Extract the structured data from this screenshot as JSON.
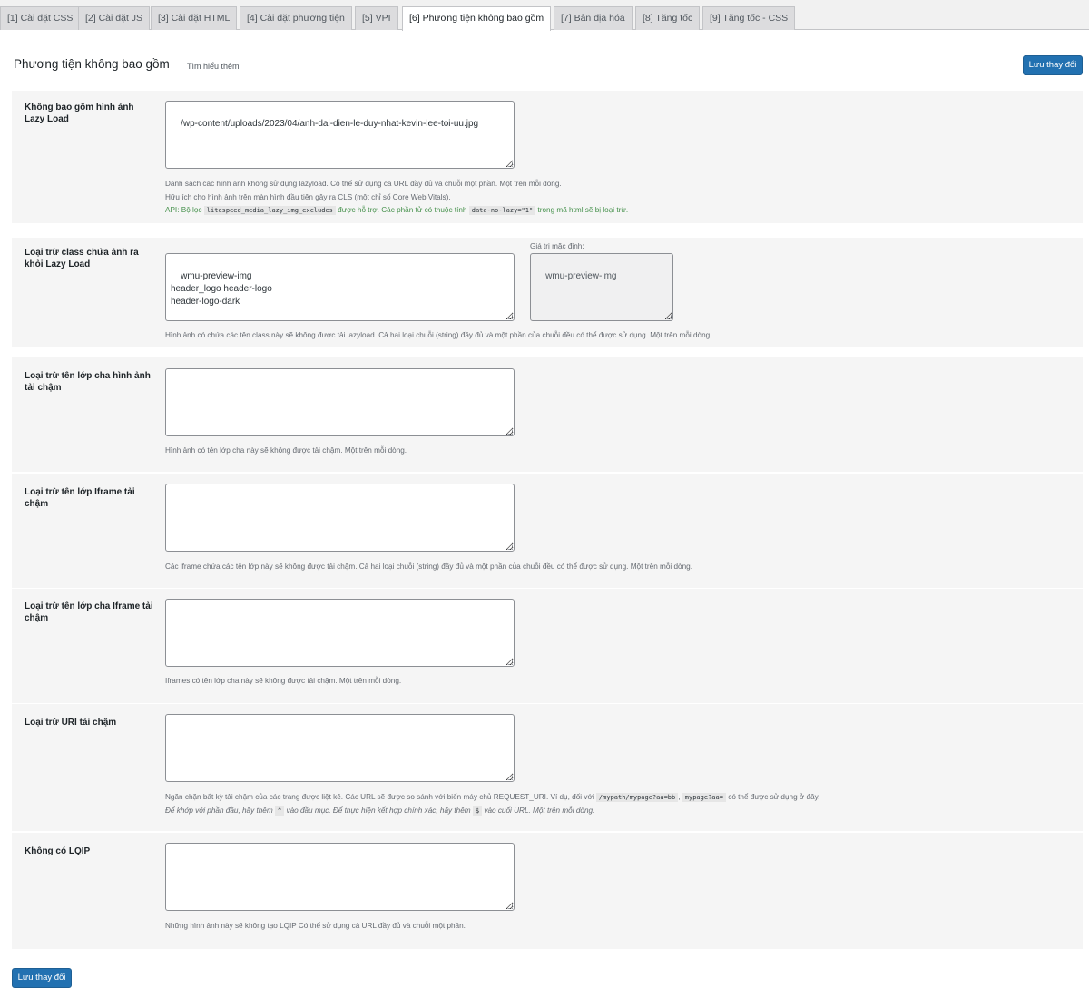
{
  "tabs": [
    {
      "label": "[1] Cài đặt CSS",
      "active": false
    },
    {
      "label": "[2] Cài đặt JS",
      "active": false
    },
    {
      "label": "[3] Cài đặt HTML",
      "active": false
    },
    {
      "label": "[4] Cài đặt phương tiện",
      "active": false
    },
    {
      "label": "[5] VPI",
      "active": false
    },
    {
      "label": "[6] Phương tiện không bao gồm",
      "active": true
    },
    {
      "label": "[7] Bản địa hóa",
      "active": false
    },
    {
      "label": "[8] Tăng tốc",
      "active": false
    },
    {
      "label": "[9] Tăng tốc - CSS",
      "active": false
    }
  ],
  "header": {
    "title": "Phương tiện không bao gồm",
    "learn_more": "Tìm hiểu thêm",
    "save_label": "Lưu thay đổi"
  },
  "rows": [
    {
      "label": "Không bao gồm hình ảnh Lazy Load",
      "value": "/wp-content/uploads/2023/04/anh-dai-dien-le-duy-nhat-kevin-lee-toi-uu.jpg",
      "desc_line1": "Danh sách các hình ảnh không sử dụng lazyload. Có thể sử dụng cả URL đầy đủ và chuỗi một phần. Một trên mỗi dòng.",
      "desc_line2": "Hữu ích cho hình ảnh trên màn hình đầu tiên gây ra CLS (một chỉ số Core Web Vitals).",
      "api_prefix": "API: Bộ lọc",
      "api_code1": "litespeed_media_lazy_img_excludes",
      "api_mid": "được hỗ trợ. Các phần tử có thuộc tính",
      "api_code2": "data-no-lazy=\"1\"",
      "api_suffix": "trong mã html sẽ bị loại trừ."
    },
    {
      "label": "Loại trừ class chứa ảnh ra khỏi Lazy Load",
      "value": "wmu-preview-img\nheader_logo header-logo\nheader-logo-dark",
      "default_label": "Giá trị mặc định:",
      "default_value": "wmu-preview-img",
      "desc_line1": "Hình ảnh có chứa các tên class này sẽ không được tải lazyload. Cả hai loại chuỗi (string) đầy đủ và một phần của chuỗi đều có thể được sử dụng. Một trên mỗi dòng."
    },
    {
      "label": "Loại trừ tên lớp cha hình ảnh tải chậm",
      "value": "",
      "desc_line1": "Hình ảnh có tên lớp cha này sẽ không được tải chậm. Một trên mỗi dòng."
    },
    {
      "label": "Loại trừ tên lớp Iframe tải chậm",
      "value": "",
      "desc_line1": "Các iframe chứa các tên lớp này sẽ không được tải chậm. Cả hai loại chuỗi (string) đầy đủ và một phần của chuỗi đều có thể được sử dụng. Một trên mỗi dòng."
    },
    {
      "label": "Loại trừ tên lớp cha Iframe tải chậm",
      "value": "",
      "desc_line1": "Iframes có tên lớp cha này sẽ không được tải chậm. Một trên mỗi dòng."
    },
    {
      "label": "Loại trừ URI tải chậm",
      "value": "",
      "desc_line1_a": "Ngăn chặn bất kỳ tải chậm của các trang được liệt kê. Các URL sẽ được so sánh với biến máy chủ REQUEST_URI. Ví dụ, đối với",
      "code1": "/mypath/mypage?aa=bb",
      "code2": "mypage?aa=",
      "desc_line1_b": "có thể được sử dụng ở đây.",
      "desc_line2_a": "Để khớp với phần đầu, hãy thêm",
      "code3": "^",
      "desc_line2_b": "vào đầu mục. Để thực hiện kết hợp chính xác, hãy thêm",
      "code4": "$",
      "desc_line2_c": "vào cuối URL. Một trên mỗi dòng."
    },
    {
      "label": "Không có LQIP",
      "value": "",
      "desc_line1": "Những hình ảnh này sẽ không tạo LQIP Có thể sử dụng cả URL đầy đủ và chuỗi một phần."
    }
  ]
}
